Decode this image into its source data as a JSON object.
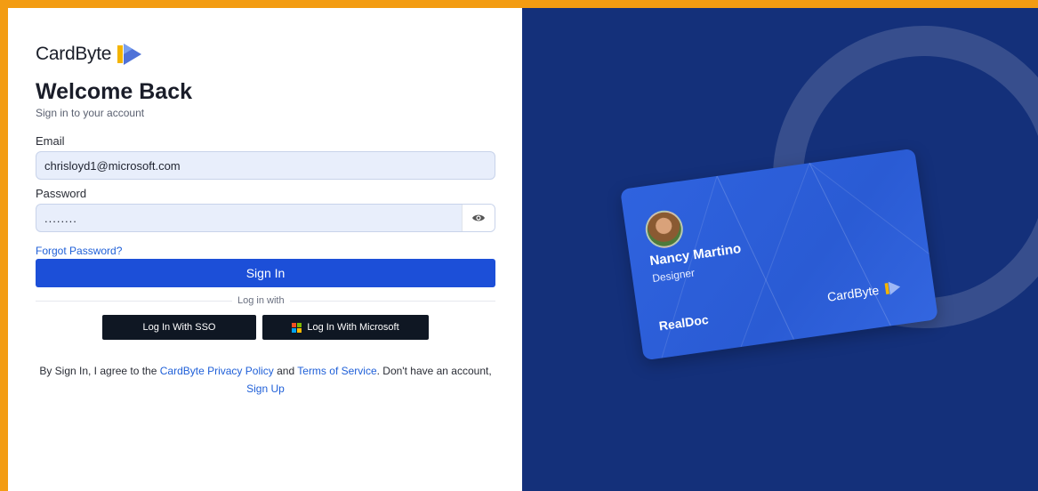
{
  "brand": {
    "name_bold": "Card",
    "name_light": "Byte"
  },
  "header": {
    "title": "Welcome Back",
    "subtitle": "Sign in to your account"
  },
  "form": {
    "email_label": "Email",
    "email_value": "chrisloyd1@microsoft.com",
    "password_label": "Password",
    "password_value": "........",
    "forgot_label": "Forgot Password?",
    "signin_label": "Sign In",
    "divider_label": "Log in with",
    "sso_label": "Log In With SSO",
    "microsoft_label": "Log In With Microsoft"
  },
  "terms": {
    "prefix": "By Sign In, I agree to the ",
    "privacy_link": "CardByte Privacy Policy",
    "and": " and ",
    "tos_link": "Terms of Service",
    "suffix": ". Don't have an account,",
    "signup_link": "Sign Up"
  },
  "card": {
    "name": "Nancy Martino",
    "role": "Designer",
    "company": "RealDoc",
    "logo_bold": "Card",
    "logo_light": "Byte"
  },
  "colors": {
    "accent": "#1c4fd8",
    "link": "#2060d8",
    "panel_bg": "#14307a",
    "frame_border": "#f39c12",
    "dark_button": "#0f1723"
  },
  "icons": [
    "brand-logo-icon",
    "eye-icon",
    "microsoft-icon"
  ]
}
